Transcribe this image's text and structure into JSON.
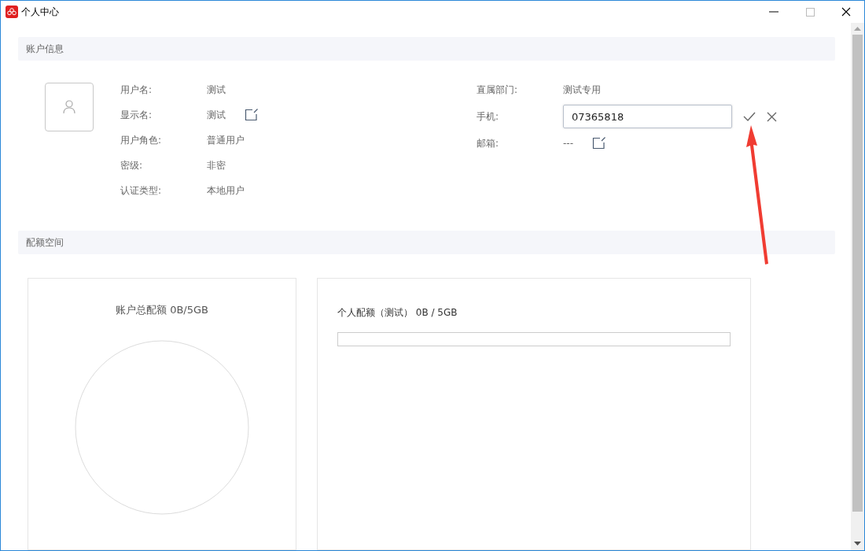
{
  "window": {
    "title": "个人中心"
  },
  "account_section": {
    "title": "账户信息",
    "fields_left": [
      {
        "label": "用户名:",
        "value": "测试",
        "kind": "text"
      },
      {
        "label": "显示名:",
        "value": "测试",
        "kind": "editable"
      },
      {
        "label": "用户角色:",
        "value": "普通用户",
        "kind": "text"
      },
      {
        "label": "密级:",
        "value": "非密",
        "kind": "text"
      },
      {
        "label": "认证类型:",
        "value": "本地用户",
        "kind": "text"
      }
    ],
    "fields_right": [
      {
        "label": "直属部门:",
        "value": "测试专用",
        "kind": "text"
      },
      {
        "label": "手机:",
        "value": "07365818",
        "kind": "editing"
      },
      {
        "label": "邮箱:",
        "value": "---",
        "kind": "editable"
      }
    ]
  },
  "quota_section": {
    "title": "配额空间",
    "total": {
      "label": "账户总配额 0B/5GB"
    },
    "personal": {
      "label": "个人配额（测试） 0B / 5GB",
      "level": 0
    }
  }
}
